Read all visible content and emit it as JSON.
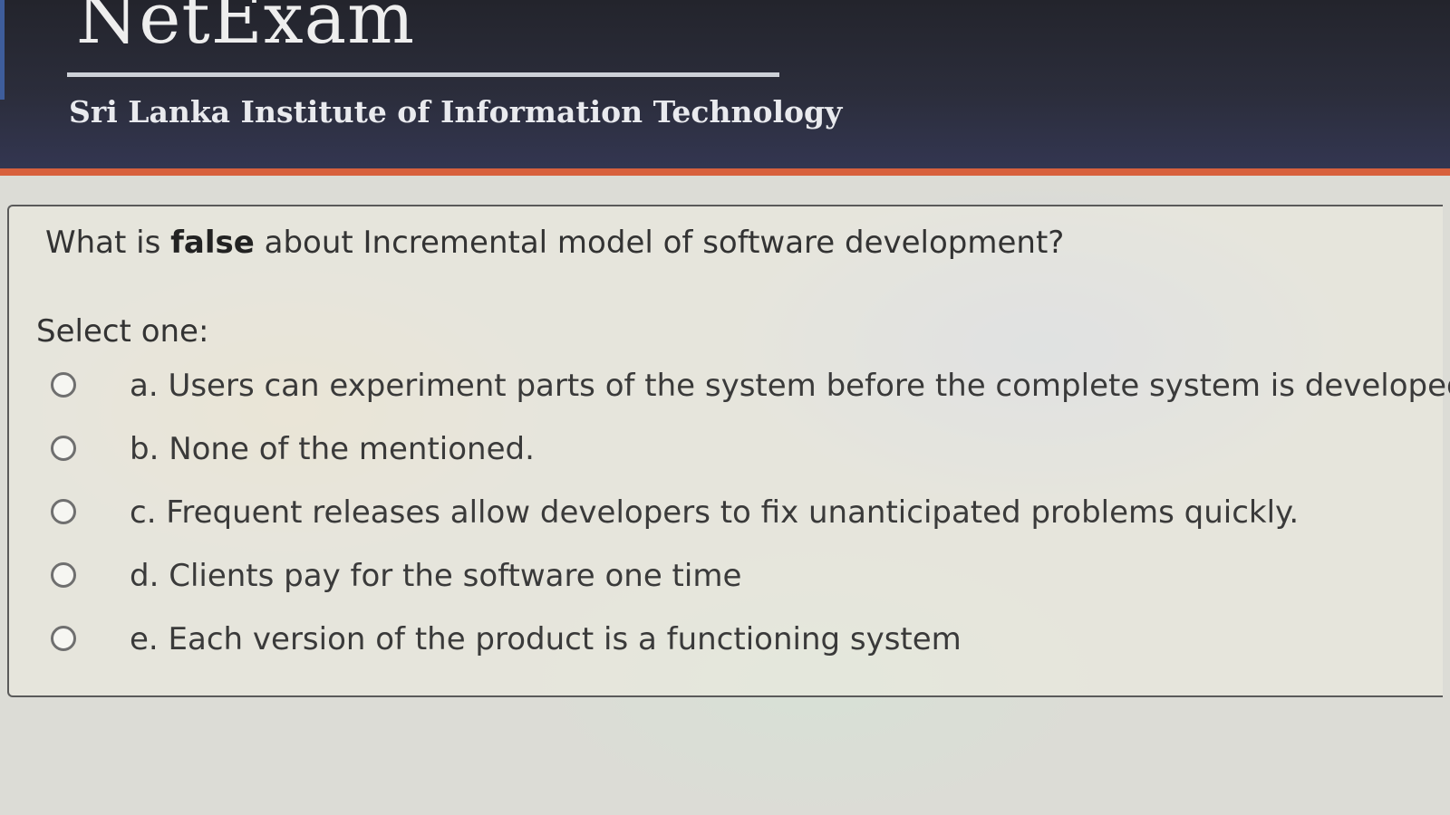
{
  "header": {
    "logo_text": "NetExam",
    "institute": "Sri Lanka Institute of Information Technology"
  },
  "question": {
    "prefix": "What is ",
    "emphasis": "false",
    "suffix": " about Incremental model of software development?",
    "select_label": "Select one:",
    "options": [
      {
        "label": "a. Users can experiment parts of the system before the complete system is developed",
        "selected": false
      },
      {
        "label": "b. None of the mentioned.",
        "selected": false
      },
      {
        "label": "c. Frequent releases allow developers to fix unanticipated problems quickly.",
        "selected": false
      },
      {
        "label": "d. Clients pay for the software one time",
        "selected": false
      },
      {
        "label": "e. Each  version of the  product is a functioning system",
        "selected": false
      }
    ]
  },
  "colors": {
    "header_bg": "#2b2d3b",
    "accent": "#d8613d"
  }
}
